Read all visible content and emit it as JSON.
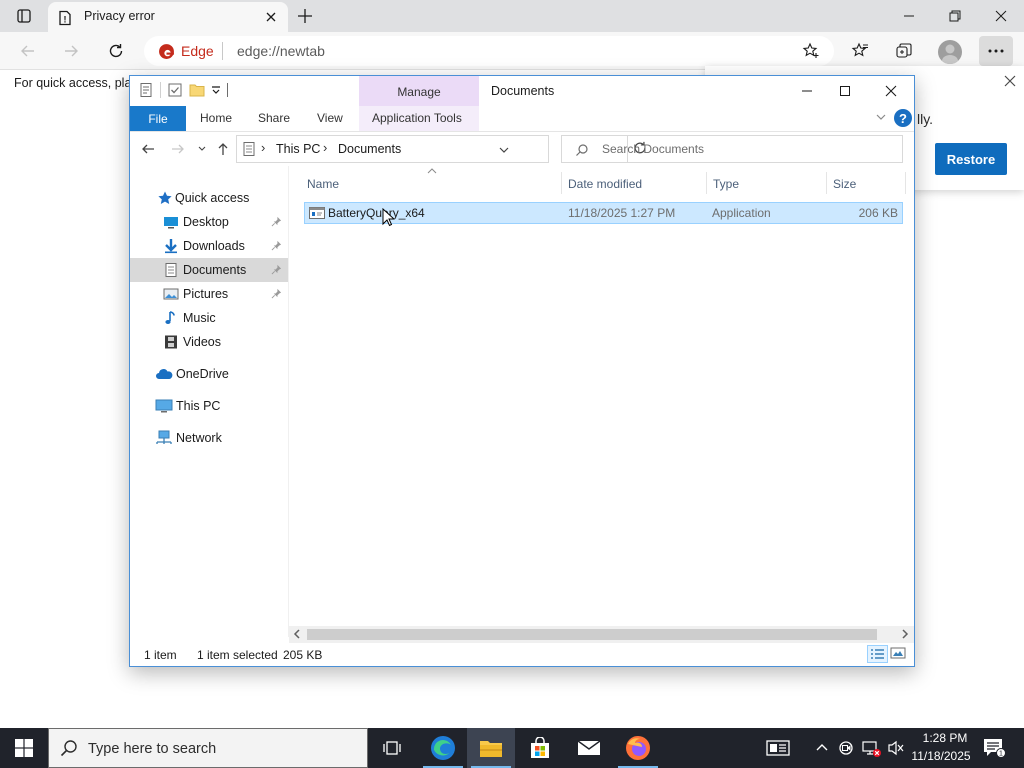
{
  "browser": {
    "tab": {
      "title": "Privacy error"
    },
    "address": {
      "engine_label": "Edge",
      "url": "edge://newtab"
    },
    "favorites_hint": "For quick access, plac",
    "colors": {
      "edge_red": "#c42b1c",
      "accent": "#0f6cbd"
    }
  },
  "restore_panel": {
    "text_fragment": "lly.",
    "button_label": "Restore"
  },
  "explorer": {
    "title": "Documents",
    "contextual_group": "Manage",
    "ribbon_tabs": {
      "file": "File",
      "home": "Home",
      "share": "Share",
      "view": "View",
      "application_tools": "Application Tools"
    },
    "breadcrumb": [
      "This PC",
      "Documents"
    ],
    "search_placeholder": "Search Documents",
    "nav": {
      "quick_access": "Quick access",
      "desktop": "Desktop",
      "downloads": "Downloads",
      "documents": "Documents",
      "pictures": "Pictures",
      "music": "Music",
      "videos": "Videos",
      "onedrive": "OneDrive",
      "this_pc": "This PC",
      "network": "Network"
    },
    "columns": {
      "name": "Name",
      "date_modified": "Date modified",
      "type": "Type",
      "size": "Size"
    },
    "files": [
      {
        "name": "BatteryQuery_x64",
        "date_modified": "11/18/2025 1:27 PM",
        "type": "Application",
        "size": "206 KB"
      }
    ],
    "status": {
      "item_count": "1 item",
      "selection": "1 item selected",
      "selection_size": "205 KB"
    }
  },
  "taskbar": {
    "search_placeholder": "Type here to search",
    "clock_time": "1:28 PM",
    "clock_date": "11/18/2025",
    "apps": [
      "task-view",
      "edge",
      "file-explorer",
      "microsoft-store",
      "mail",
      "firefox"
    ]
  }
}
